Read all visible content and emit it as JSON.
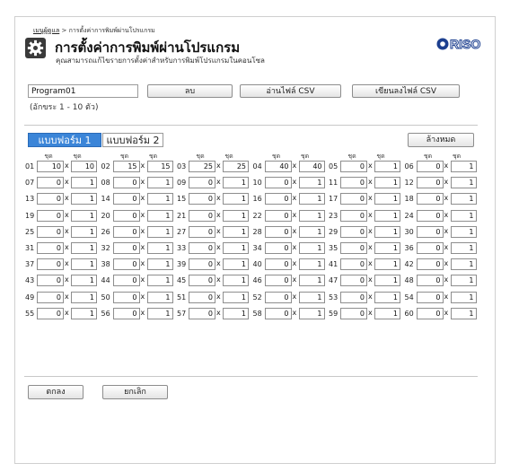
{
  "breadcrumb": {
    "home": "เมนูผู้ดูแล",
    "separator": ">",
    "current": "การตั้งค่าการพิมพ์ผ่านโปรแกรม"
  },
  "page": {
    "title": "การตั้งค่าการพิมพ์ผ่านโปรแกรม",
    "subtitle": "คุณสามารถแก้ไขรายการตั้งค่าสำหรับการพิมพ์โปรแกรมในคอนโซล",
    "icon": "gear-icon"
  },
  "logo": {
    "text": "RISO",
    "color": "#1c3f8f"
  },
  "program": {
    "name_value": "Program01",
    "hint": "(อักขระ 1 - 10 ตัว)"
  },
  "buttons": {
    "delete": "ลบ",
    "read_csv": "อ่านไฟล์ CSV",
    "write_csv": "เขียนลงไฟล์ CSV",
    "clear_all": "ล้างหมด",
    "ok": "ตกลง",
    "cancel": "ยกเลิก"
  },
  "tabs": [
    {
      "label": "แบบฟอร์ม 1",
      "active": true
    },
    {
      "label": "แบบฟอร์ม 2",
      "active": false
    }
  ],
  "colors": {
    "tab_active": "#3b85d8"
  },
  "grid": {
    "header_label": "ชุด",
    "multiply_sign": "x",
    "entries": [
      {
        "no": "01",
        "copies": "10",
        "sets": "10"
      },
      {
        "no": "02",
        "copies": "15",
        "sets": "15"
      },
      {
        "no": "03",
        "copies": "25",
        "sets": "25"
      },
      {
        "no": "04",
        "copies": "40",
        "sets": "40"
      },
      {
        "no": "05",
        "copies": "0",
        "sets": "1"
      },
      {
        "no": "06",
        "copies": "0",
        "sets": "1"
      },
      {
        "no": "07",
        "copies": "0",
        "sets": "1"
      },
      {
        "no": "08",
        "copies": "0",
        "sets": "1"
      },
      {
        "no": "09",
        "copies": "0",
        "sets": "1"
      },
      {
        "no": "10",
        "copies": "0",
        "sets": "1"
      },
      {
        "no": "11",
        "copies": "0",
        "sets": "1"
      },
      {
        "no": "12",
        "copies": "0",
        "sets": "1"
      },
      {
        "no": "13",
        "copies": "0",
        "sets": "1"
      },
      {
        "no": "14",
        "copies": "0",
        "sets": "1"
      },
      {
        "no": "15",
        "copies": "0",
        "sets": "1"
      },
      {
        "no": "16",
        "copies": "0",
        "sets": "1"
      },
      {
        "no": "17",
        "copies": "0",
        "sets": "1"
      },
      {
        "no": "18",
        "copies": "0",
        "sets": "1"
      },
      {
        "no": "19",
        "copies": "0",
        "sets": "1"
      },
      {
        "no": "20",
        "copies": "0",
        "sets": "1"
      },
      {
        "no": "21",
        "copies": "0",
        "sets": "1"
      },
      {
        "no": "22",
        "copies": "0",
        "sets": "1"
      },
      {
        "no": "23",
        "copies": "0",
        "sets": "1"
      },
      {
        "no": "24",
        "copies": "0",
        "sets": "1"
      },
      {
        "no": "25",
        "copies": "0",
        "sets": "1"
      },
      {
        "no": "26",
        "copies": "0",
        "sets": "1"
      },
      {
        "no": "27",
        "copies": "0",
        "sets": "1"
      },
      {
        "no": "28",
        "copies": "0",
        "sets": "1"
      },
      {
        "no": "29",
        "copies": "0",
        "sets": "1"
      },
      {
        "no": "30",
        "copies": "0",
        "sets": "1"
      },
      {
        "no": "31",
        "copies": "0",
        "sets": "1"
      },
      {
        "no": "32",
        "copies": "0",
        "sets": "1"
      },
      {
        "no": "33",
        "copies": "0",
        "sets": "1"
      },
      {
        "no": "34",
        "copies": "0",
        "sets": "1"
      },
      {
        "no": "35",
        "copies": "0",
        "sets": "1"
      },
      {
        "no": "36",
        "copies": "0",
        "sets": "1"
      },
      {
        "no": "37",
        "copies": "0",
        "sets": "1"
      },
      {
        "no": "38",
        "copies": "0",
        "sets": "1"
      },
      {
        "no": "39",
        "copies": "0",
        "sets": "1"
      },
      {
        "no": "40",
        "copies": "0",
        "sets": "1"
      },
      {
        "no": "41",
        "copies": "0",
        "sets": "1"
      },
      {
        "no": "42",
        "copies": "0",
        "sets": "1"
      },
      {
        "no": "43",
        "copies": "0",
        "sets": "1"
      },
      {
        "no": "44",
        "copies": "0",
        "sets": "1"
      },
      {
        "no": "45",
        "copies": "0",
        "sets": "1"
      },
      {
        "no": "46",
        "copies": "0",
        "sets": "1"
      },
      {
        "no": "47",
        "copies": "0",
        "sets": "1"
      },
      {
        "no": "48",
        "copies": "0",
        "sets": "1"
      },
      {
        "no": "49",
        "copies": "0",
        "sets": "1"
      },
      {
        "no": "50",
        "copies": "0",
        "sets": "1"
      },
      {
        "no": "51",
        "copies": "0",
        "sets": "1"
      },
      {
        "no": "52",
        "copies": "0",
        "sets": "1"
      },
      {
        "no": "53",
        "copies": "0",
        "sets": "1"
      },
      {
        "no": "54",
        "copies": "0",
        "sets": "1"
      },
      {
        "no": "55",
        "copies": "0",
        "sets": "1"
      },
      {
        "no": "56",
        "copies": "0",
        "sets": "1"
      },
      {
        "no": "57",
        "copies": "0",
        "sets": "1"
      },
      {
        "no": "58",
        "copies": "0",
        "sets": "1"
      },
      {
        "no": "59",
        "copies": "0",
        "sets": "1"
      },
      {
        "no": "60",
        "copies": "0",
        "sets": "1"
      }
    ]
  }
}
